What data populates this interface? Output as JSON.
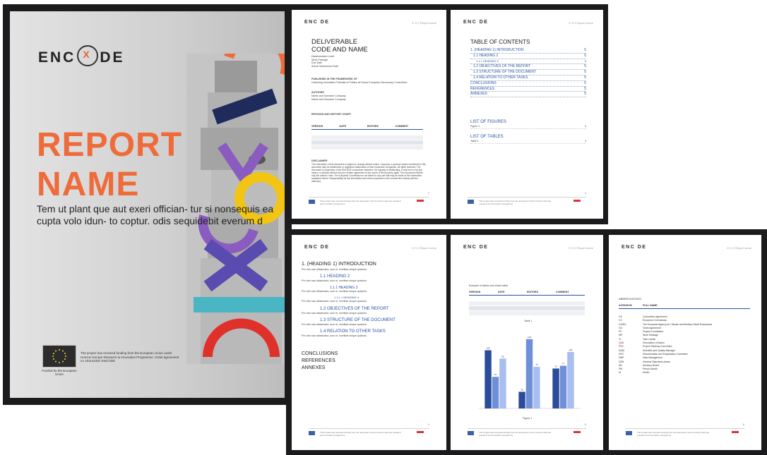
{
  "cover": {
    "logo_left": "ENC",
    "logo_mark": "X",
    "logo_right": "DE",
    "title_line1": "REPORT",
    "title_line2": "NAME",
    "subtitle": "Tem ut plant que aut exeri offician- tur si nonsequis ea cupta volo idun- to coptur. odis sequidebit everum d",
    "eu_caption": "Funded by the European Union",
    "funding_text": "The project has received funding from the European Union under Horizon Europe Research & Innovation Programme. Grant agreement no 101132481 ENCODE"
  },
  "header": {
    "logo": "ENC DE",
    "doc_label": "D X.X Report name"
  },
  "footer": {
    "text": "This project has received funding from the European Union's Horizon Europe research and innovation programme"
  },
  "page1": {
    "title_line1": "DELIVERABLE",
    "title_line2": "CODE AND NAME",
    "meta": [
      "Dissemination Level",
      "Work Package",
      "Due Date",
      "Actual Submission Date"
    ],
    "published_head": "PUBLISHED IN THE FRAMEWORK OF",
    "published_text": "Unlocking Innovation Potential of Publics at Future European Democracy Consortium",
    "authors_head": "AUTHORS",
    "authors": [
      "Name and Surname Company",
      "Name and Surname Company"
    ],
    "revision_head": "REVISION AND HISTORY CHART",
    "revision_cols": [
      "VERSION",
      "DATE",
      "EDITORS",
      "COMMENT"
    ],
    "disclaimer_head": "DISCLAIMER",
    "disclaimer_text": "The information in this document is subject to change without notice. Company or product names mentioned in this document may be trademarks or registered trademarks of their respective companies. All rights reserved. The document is proprietary of the ENCODE consortium members. No copying or distributing, in any form or by any means, is allowed without the prior written agreement of the owner of the property rights. This document reflects only the authors' view. The European Commission is not liable for any use that may be made of the information contained herein. Responsibility for the information and views expressed in the content lies entirely with the author(s).",
    "page_no": "2"
  },
  "page2": {
    "title": "TABLE OF CONTENTS",
    "entries": [
      {
        "label": "1. (HEADING 1) INTRODUCTION",
        "page": "5"
      },
      {
        "label": "1.1 HEADING 2",
        "page": "5"
      },
      {
        "label": "1.1.1 HEADING 3",
        "page": "5"
      },
      {
        "label": "1.2 OBJECTIVES OF THE REPORT",
        "page": "5"
      },
      {
        "label": "1.3 STRUCTURE OF THE DOCUMENT",
        "page": "5"
      },
      {
        "label": "1.4 RELATION TO OTHER TASKS",
        "page": "5"
      },
      {
        "label": "CONCLUSIONS",
        "page": "5"
      },
      {
        "label": "REFERENCES",
        "page": "5"
      },
      {
        "label": "ANNEXES",
        "page": "5"
      }
    ],
    "figures_head": "LIST OF FIGURES",
    "figures_item": "Figure 1",
    "tables_head": "LIST OF TABLES",
    "tables_item": "Table 1",
    "page_no": "3"
  },
  "page3": {
    "title": "1. (HEADING 1) INTRODUCTION",
    "body": "Pre velo sae aliasecaria, sum re, invelitae sinque quaturio.",
    "h2": "1.1 HEADING 2",
    "h3": "1.1.1 HEADING 3",
    "h4": "1.1.1.1 HEADING 4",
    "objectives": "1.2 OBJECTIVES OF THE REPORT",
    "structure": "1.3 STRUCTURE OF THE DOCUMENT",
    "relation": "1.4 RELATION TO OTHER TASKS",
    "end_items": [
      "CONCLUSIONS",
      "REFERENCES",
      "ANNEXES"
    ],
    "page_no": "4"
  },
  "page4": {
    "caption": "Example of tables and charts table",
    "cols": [
      "VERSION",
      "DATE",
      "EDITORS",
      "COMMENT"
    ],
    "table_label": "Table 1",
    "figure_label": "Figure 1",
    "page_no": "5"
  },
  "chart_data": {
    "type": "bar",
    "categories": [
      "A",
      "B",
      "C"
    ],
    "series": [
      {
        "values": [
          105,
          30,
          72
        ]
      },
      {
        "values": [
          57,
          125,
          77
        ]
      },
      {
        "values": [
          90,
          75,
          102
        ]
      }
    ],
    "ylim": [
      0,
      140
    ],
    "colors": [
      "#2b4c9b",
      "#6f8fd6",
      "#a8bdf0"
    ]
  },
  "page5": {
    "head": "ABBREVIATIONS",
    "cols": [
      "ACRONYM",
      "FULL NAME"
    ],
    "rows": [
      [
        "CA",
        "Consortium Agreement"
      ],
      [
        "CC",
        "European Commission"
      ],
      [
        "CINEA",
        "The European Agency for Climate and Medium-Sized Enterprises"
      ],
      [
        "GA",
        "Grant Agreement"
      ],
      [
        "PC",
        "Project Coordinator"
      ],
      [
        "WP",
        "Work Package"
      ],
      [
        "TL",
        "Task Leader"
      ],
      [
        "QAB",
        "Description of Action"
      ],
      [
        "PSC",
        "Project Steering Committee"
      ],
      [
        "SQM",
        "Scientific and Quality Manager"
      ],
      [
        "DEC",
        "Dissemination and Exploitation Committee"
      ],
      [
        "DMP",
        "Data Management"
      ],
      [
        "GEN",
        "General Objectives Areas"
      ],
      [
        "AB",
        "Advisory Board"
      ],
      [
        "PM",
        "Person Month"
      ],
      [
        "M",
        "Month"
      ]
    ],
    "page_no": "6"
  }
}
